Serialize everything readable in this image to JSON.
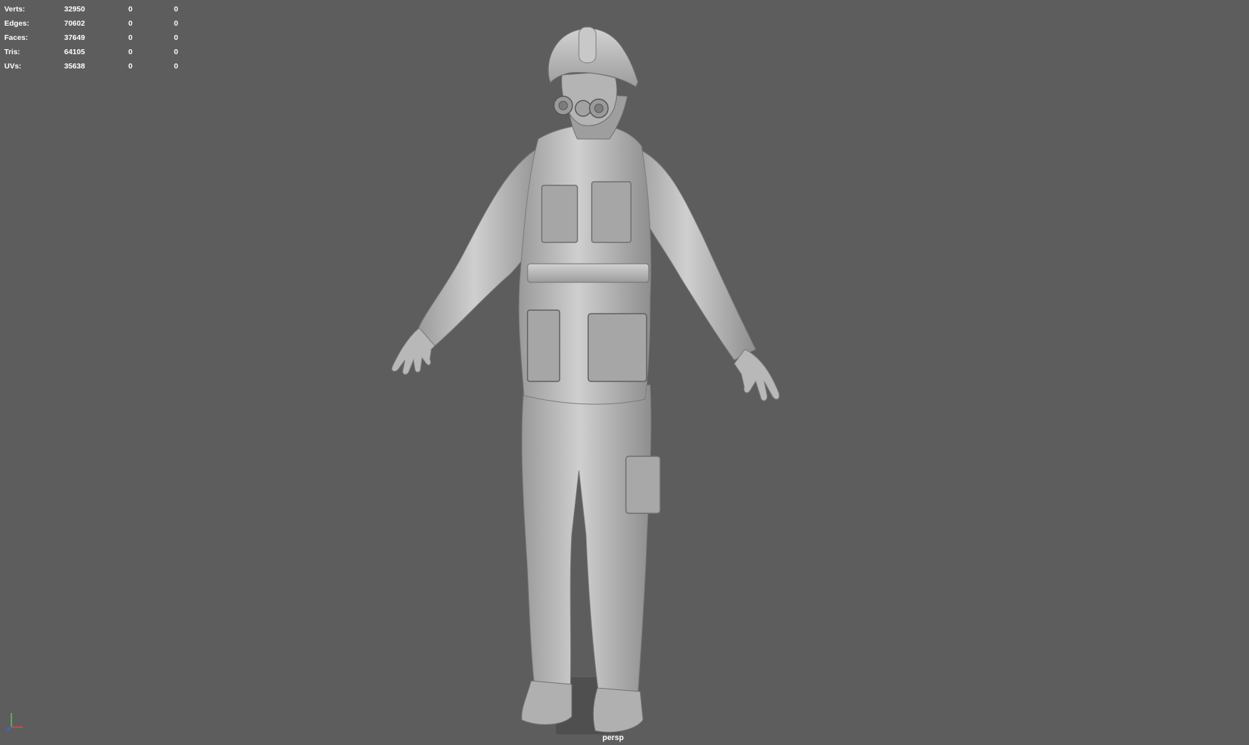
{
  "hud": {
    "rows": [
      {
        "label": "Verts:",
        "values": [
          "32950",
          "0",
          "0"
        ]
      },
      {
        "label": "Edges:",
        "values": [
          "70602",
          "0",
          "0"
        ]
      },
      {
        "label": "Faces:",
        "values": [
          "37649",
          "0",
          "0"
        ]
      },
      {
        "label": "Tris:",
        "values": [
          "64105",
          "0",
          "0"
        ]
      },
      {
        "label": "UVs:",
        "values": [
          "35638",
          "0",
          "0"
        ]
      }
    ]
  },
  "viewport": {
    "camera": "persp",
    "background_color": "#5d5d5d",
    "model_color": "#bdbdbd"
  },
  "axis_gizmo": {
    "x_color": "#d84040",
    "y_color": "#40c040",
    "z_color": "#4060e0"
  }
}
